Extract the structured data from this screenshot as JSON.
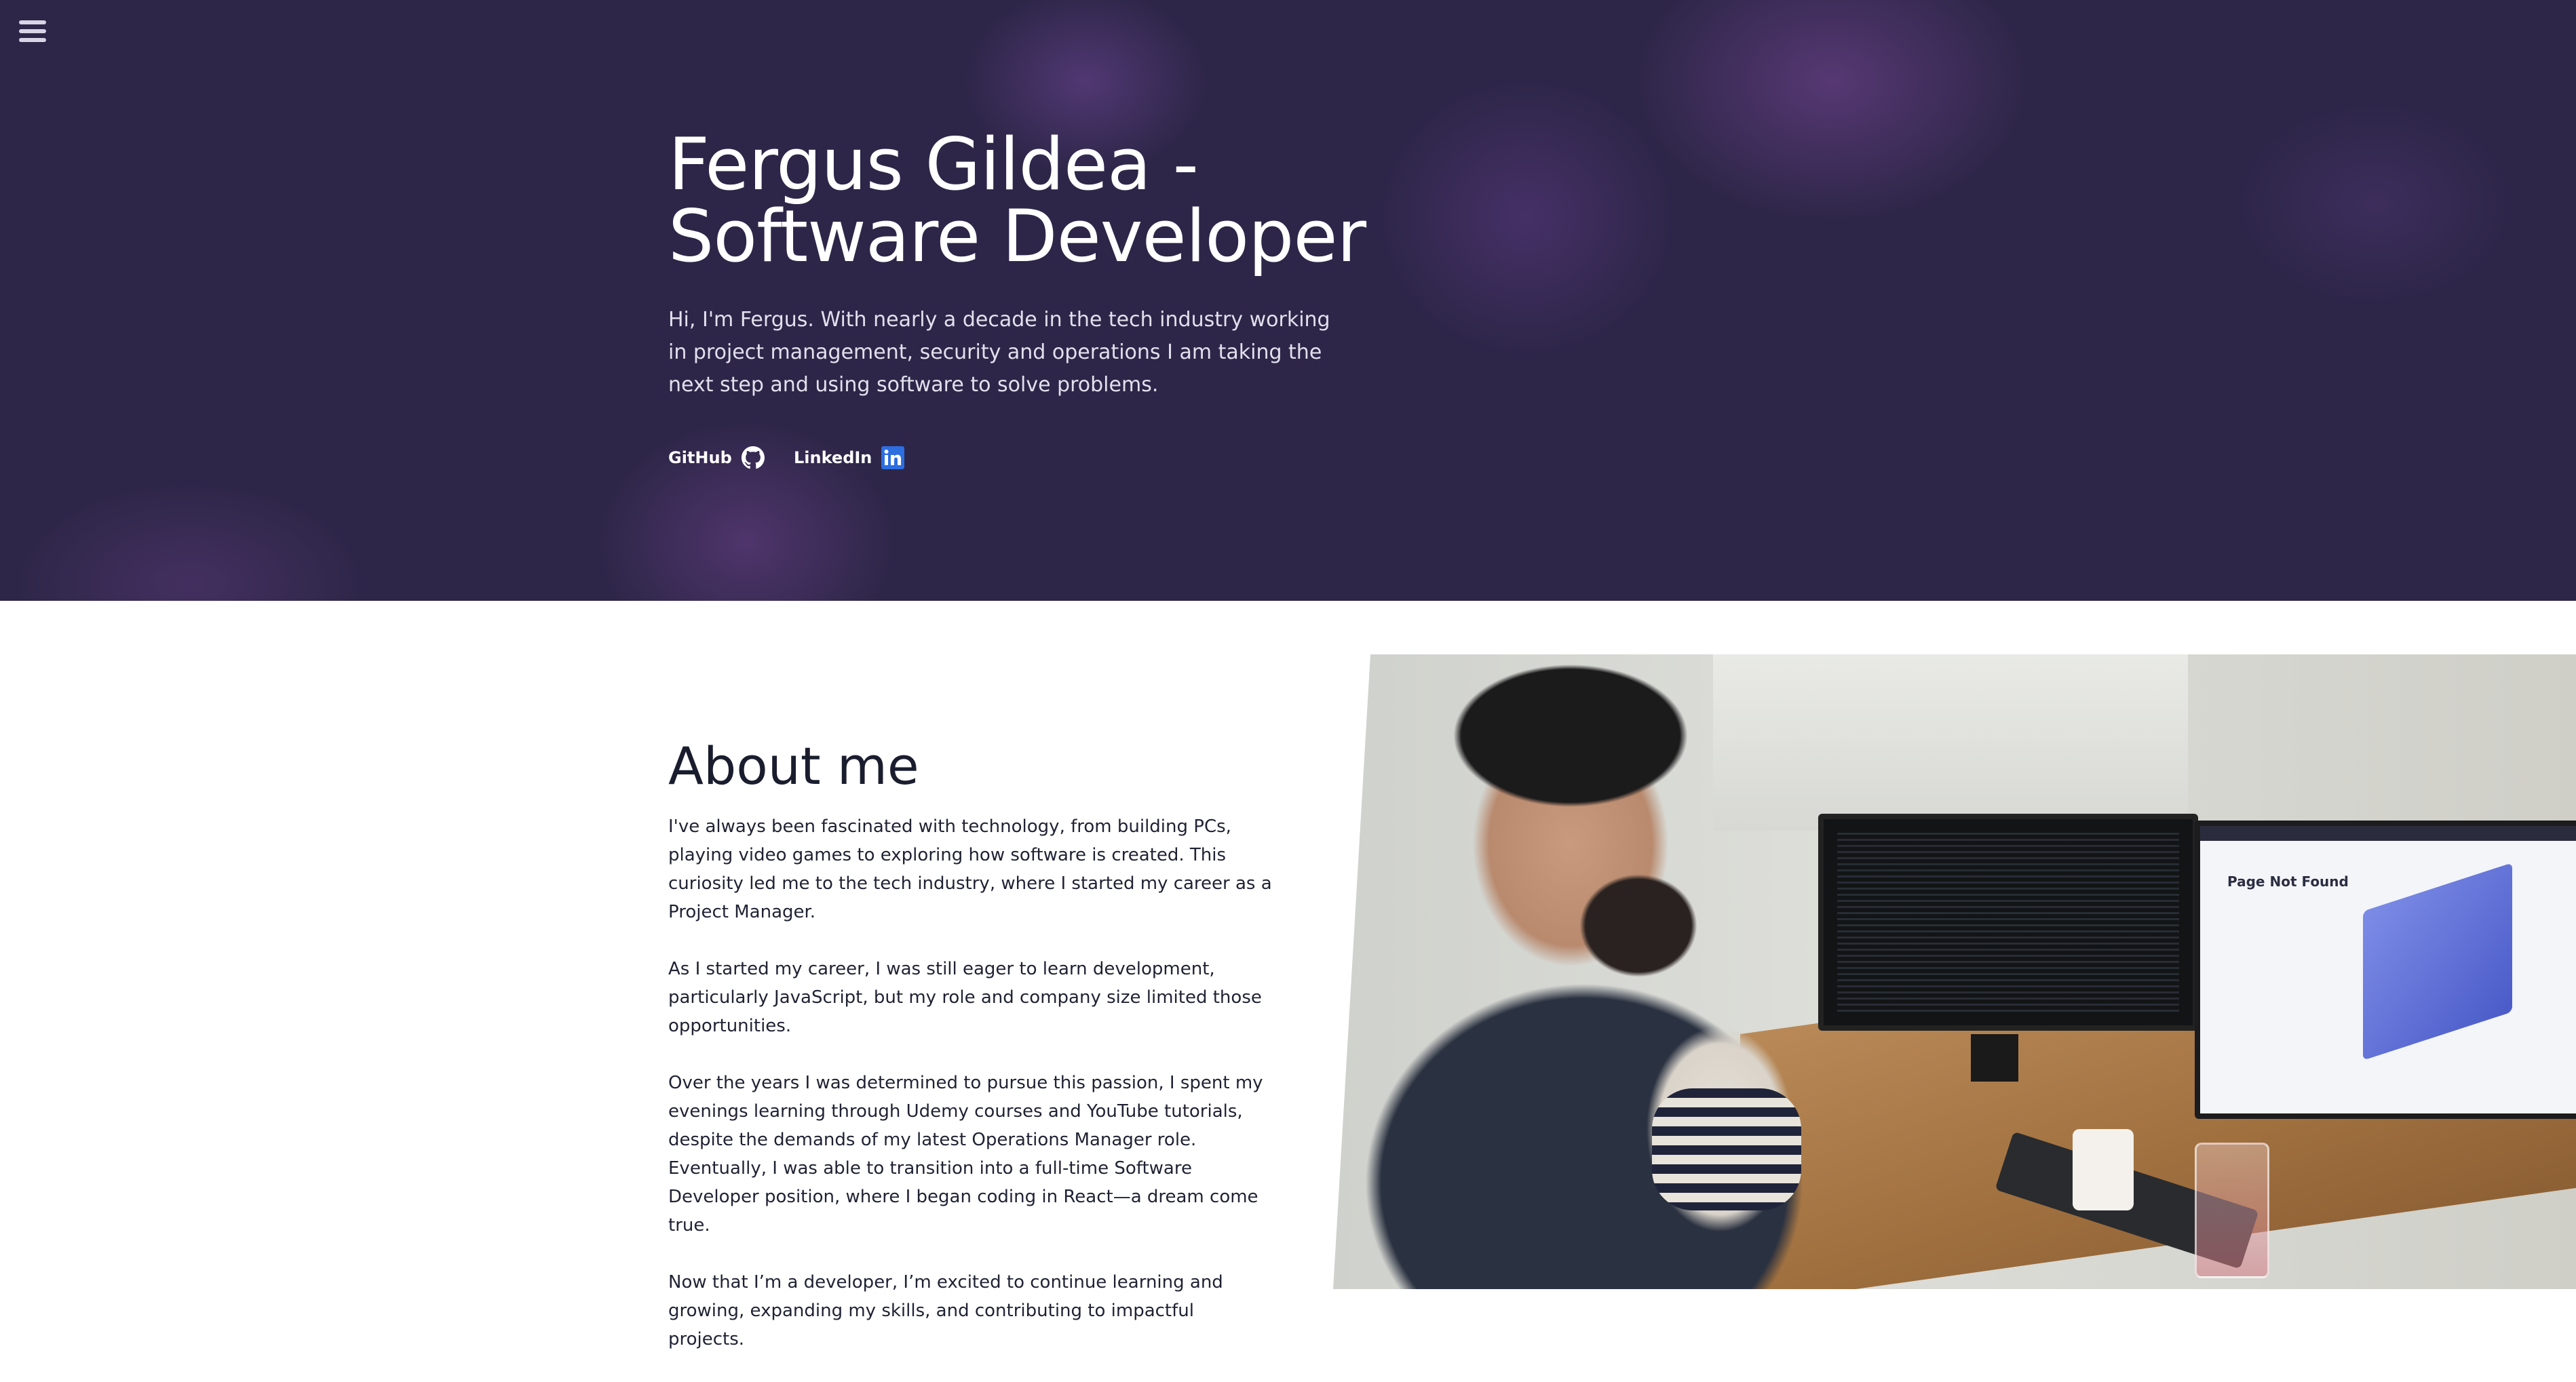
{
  "nav": {
    "menu_icon": "hamburger-menu-icon"
  },
  "hero": {
    "title_line1": "Fergus Gildea -",
    "title_line2": "Software Developer",
    "intro": "Hi, I'm Fergus. With nearly a decade in the tech industry working in project management, security and operations I am taking the next step and using software to solve problems.",
    "links": [
      {
        "label": "GitHub",
        "icon": "github-icon"
      },
      {
        "label": "LinkedIn",
        "icon": "linkedin-icon"
      }
    ]
  },
  "about": {
    "title": "About me",
    "paragraphs": [
      "I've always been fascinated with technology, from building PCs, playing video games to exploring how software is created. This curiosity led me to the tech industry, where I started my career as a Project Manager.",
      "As I started my career, I was still eager to learn development, particularly JavaScript, but my role and company size limited those opportunities.",
      "Over the years I was determined to pursue this passion, I spent my evenings learning through Udemy courses and YouTube tutorials, despite the demands of my latest Operations Manager role. Eventually, I was able to transition into a full-time Software Developer position, where I began coding in React—a dream come true.",
      "Now that I’m a developer, I’m excited to continue learning and growing, expanding my skills, and contributing to impactful projects."
    ],
    "photo_screen_text": "Page Not Found"
  },
  "colors": {
    "hero_bg": "#2d2648",
    "hero_text": "#ffffff",
    "body_text": "#1f2233",
    "linkedin_blue": "#2d6ee0"
  }
}
